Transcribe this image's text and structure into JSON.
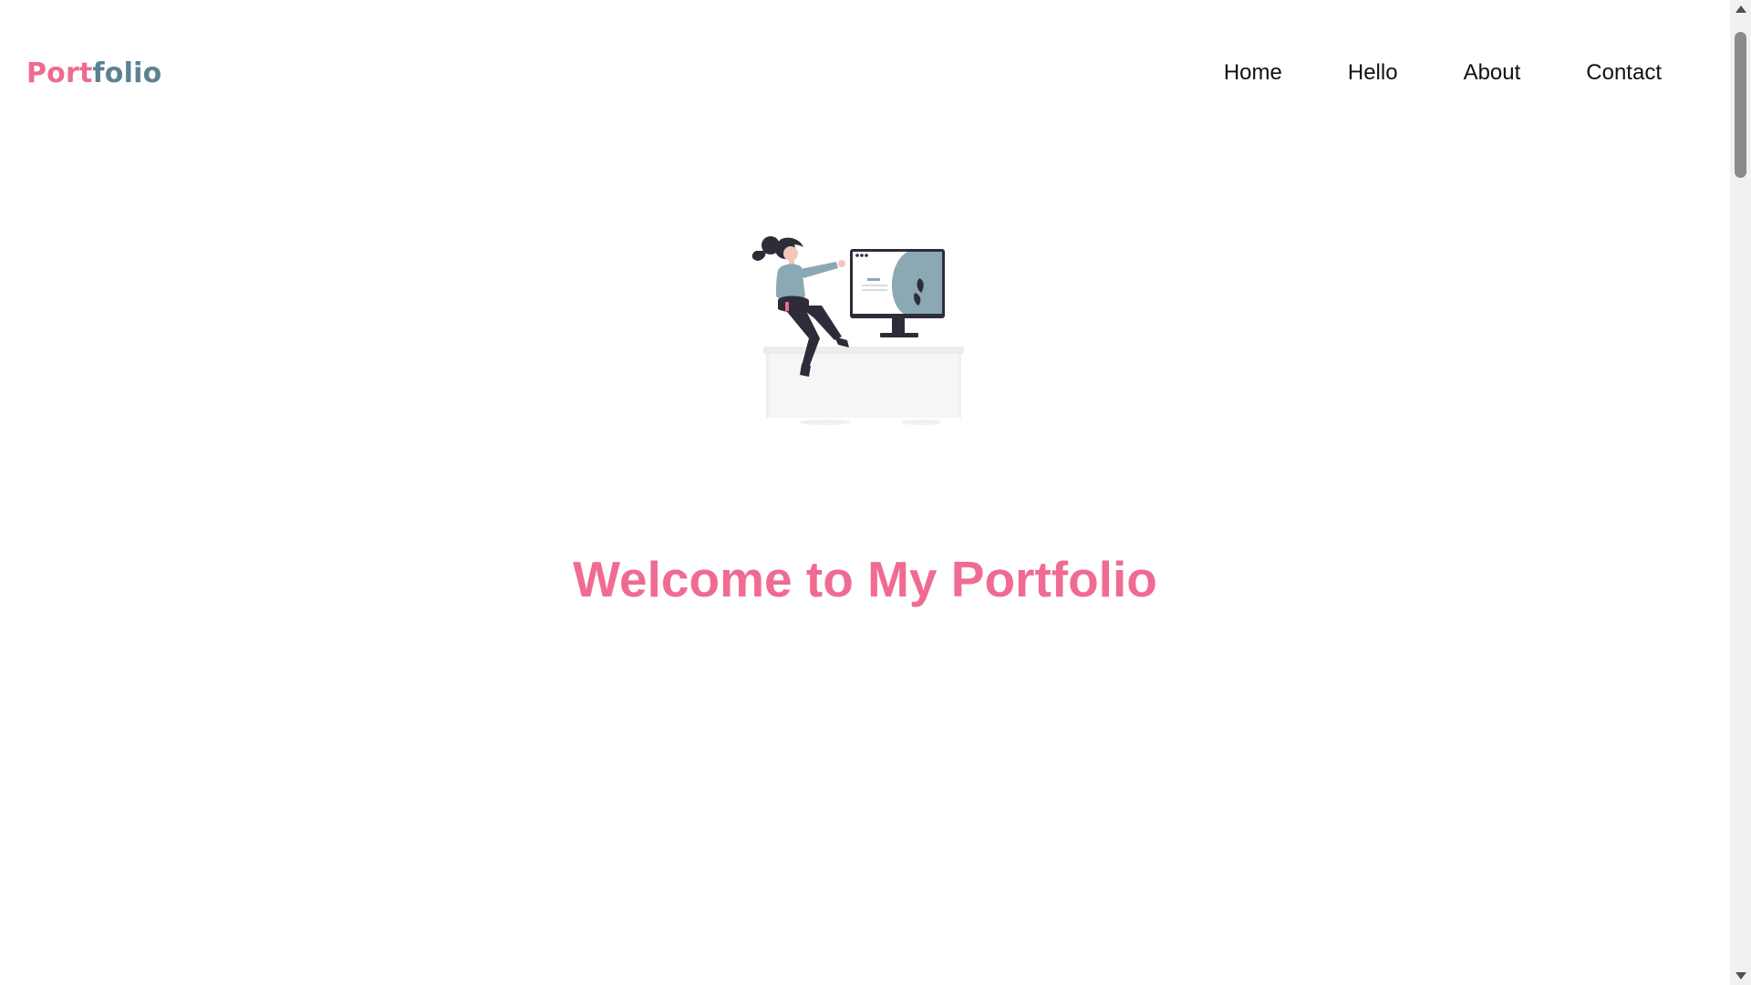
{
  "header": {
    "logo": {
      "part_a": "Port",
      "part_b": "folio"
    },
    "nav": [
      {
        "label": "Home"
      },
      {
        "label": "Hello"
      },
      {
        "label": "About"
      },
      {
        "label": "Contact"
      }
    ]
  },
  "hero": {
    "illustration": "woman-at-computer-illustration",
    "title": "Welcome to My Portfolio"
  },
  "colors": {
    "accent_pink": "#f06b92",
    "logo_teal": "#5e8191",
    "nav_text": "#111111",
    "background": "#ffffff"
  },
  "scrollbar": {
    "up_icon": "triangle-up-icon",
    "down_icon": "triangle-down-icon"
  }
}
